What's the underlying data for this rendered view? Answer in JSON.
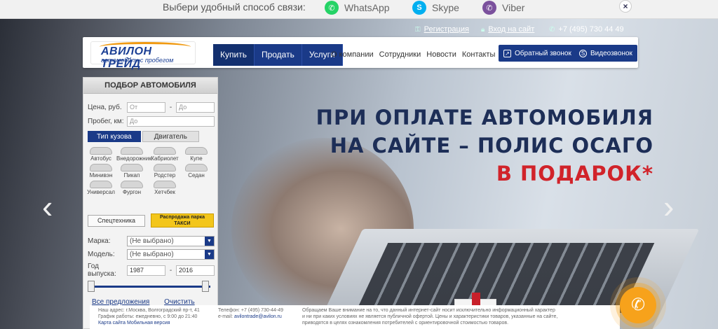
{
  "topbar": {
    "prompt": "Выбери удобный способ связи:",
    "channels": [
      {
        "name": "WhatsApp",
        "icon": "whatsapp-icon",
        "color": "#25d366"
      },
      {
        "name": "Skype",
        "icon": "skype-icon",
        "color": "#00aff0"
      },
      {
        "name": "Viber",
        "icon": "viber-icon",
        "color": "#7b519d"
      }
    ],
    "close_symbol": "×"
  },
  "header": {
    "register": "Регистрация",
    "login": "Вход на сайт",
    "phone": "+7 (495) 730 44 49"
  },
  "logo": {
    "name": "АВИЛОН ТРЕЙД",
    "tagline": "автомобили с пробегом"
  },
  "nav": {
    "main": [
      "Купить",
      "Продать",
      "Услуги"
    ],
    "secondary": [
      "О компании",
      "Сотрудники",
      "Новости",
      "Контакты"
    ],
    "callback": "Обратный звонок",
    "video": "Видеозвонок"
  },
  "hero": {
    "line1": "ПРИ ОПЛАТЕ АВТОМОБИЛЯ",
    "line2": "НА САЙТЕ – ПОЛИС ОСАГО",
    "line3": "В ПОДАРОК*",
    "prev": "‹",
    "next": "›"
  },
  "search": {
    "title": "ПОДБОР АВТОМОБИЛЯ",
    "price_label": "Цена, руб.",
    "price_from": "От",
    "price_to": "До",
    "dash": "-",
    "mileage_label": "Пробег, км:",
    "mileage_to": "До",
    "tab_body": "Тип кузова",
    "tab_engine": "Двигатель",
    "body_types": [
      "Автобус",
      "Внедорожник",
      "Кабриолет",
      "Купе",
      "Минивэн",
      "Пикап",
      "Родстер",
      "Седан",
      "Универсал",
      "Фургон",
      "Хетчбек"
    ],
    "special": "Спецтехника",
    "taxi_line1": "Распродажа парка",
    "taxi_line2": "ТАКСИ",
    "brand_label": "Марка:",
    "brand_value": "(Не выбрано)",
    "model_label": "Модель:",
    "model_value": "(Не выбрано)",
    "year_label": "Год выпуска:",
    "year_from": "1987",
    "year_to": "2016",
    "all_offers": "Все предложения",
    "clear": "Очистить фильтр"
  },
  "footer": {
    "address": "Наш адрес: г.Москва, Волгоградский пр-т, 41",
    "hours": "График работы: ежедневно, с 9:00 до 21:40",
    "links": "Карта сайта Мобильная версия",
    "phone": "Телефон: +7 (495) 730-44-49",
    "email_label": "e-mail:",
    "email": "avilontrade@avilon.ru",
    "notice1": "Обращаем Ваше внимание на то, что данный интернет-сайт носит исключительно информационный характер",
    "notice2": "и ни при каких условиях не является публичной офертой. Цены и характеристики товаров, указанные на сайте,",
    "notice3": "приводятся в целях ознакомления потребителей с ориентировочной стоимостью товаров."
  }
}
